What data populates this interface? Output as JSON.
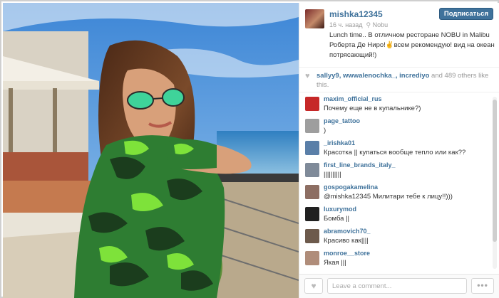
{
  "post": {
    "username": "mishka12345",
    "follow_label": "Подписаться",
    "time_ago": "16 ч. назад",
    "location": "Nobu",
    "caption": "Lunch time.. В отличном ресторане NOBU in Malibu Роберта Де Ниро!✌всем рекомендую! вид на океан потрясающий!)"
  },
  "likes": {
    "users": "sallyy9, wwwalenochka_, incrediyo",
    "joiner": " and ",
    "count_text": "489",
    "suffix": " others like this."
  },
  "comments": [
    {
      "user": "maxim_official_rus",
      "text": "Почему еще не в купальнике?)"
    },
    {
      "user": "page_tattoo",
      "text": ")"
    },
    {
      "user": "_irishka01",
      "text": "Красотка || купаться вообще тепло или как??"
    },
    {
      "user": "first_line_brands_italy_",
      "text": "||||||||||"
    },
    {
      "user": "gospogakamelina",
      "text": "@mishka12345 Милитари тебе к лицу!!)))"
    },
    {
      "user": "luxurymod",
      "text": "Бомба ||"
    },
    {
      "user": "abramovich70_",
      "text": "Красиво как||||"
    },
    {
      "user": "monroe__store",
      "text": "Якая |||"
    }
  ],
  "footer": {
    "comment_placeholder": "Leave a comment...",
    "more_label": "•••"
  },
  "icons": {
    "heart": "heart-icon",
    "location": "location-pin-icon",
    "more": "ellipsis-icon"
  },
  "colors": {
    "accent": "#3f729b",
    "meta": "#999999"
  }
}
